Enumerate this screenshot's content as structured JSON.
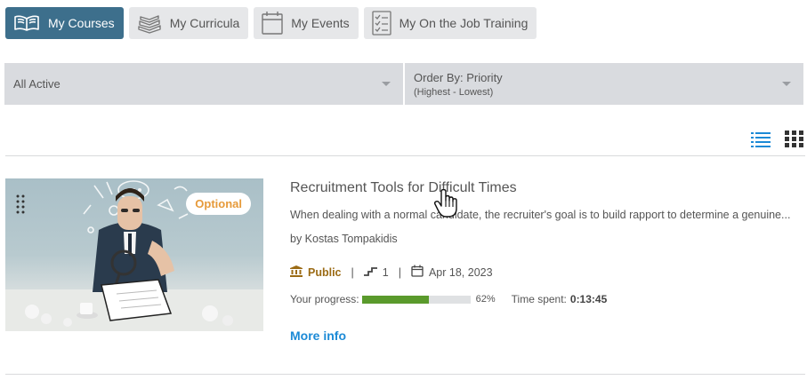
{
  "tabs": [
    {
      "label": "My Courses",
      "icon": "open-book-icon",
      "active": true
    },
    {
      "label": "My Curricula",
      "icon": "books-stack-icon",
      "active": false
    },
    {
      "label": "My Events",
      "icon": "calendar-icon",
      "active": false
    },
    {
      "label": "My On the Job Training",
      "icon": "checklist-icon",
      "active": false
    }
  ],
  "filters": {
    "status": {
      "selected": "All Active"
    },
    "order": {
      "selected": "Order By: Priority",
      "sub": "(Highest - Lowest)"
    }
  },
  "view_toggle": {
    "list_icon": "list-view-icon",
    "grid_icon": "grid-view-icon",
    "active": "list",
    "accent": "#1c8ad6"
  },
  "course": {
    "badge": "Optional",
    "title": "Recruitment Tools for Difficult Times",
    "description": "When dealing with a normal candidate, the recruiter's goal is to build rapport to determine a genuine...",
    "author": "by Kostas Tompakidis",
    "visibility": "Public",
    "sep1": "|",
    "steps": "1",
    "sep2": "|",
    "date": "Apr 18, 2023",
    "progress_label": "Your progress:",
    "progress_percent": 62,
    "progress_text": "62%",
    "time_label": "Time spent:",
    "time_value": "0:13:45",
    "more_info": "More info"
  },
  "colors": {
    "tab_active": "#3d6f8c",
    "progress": "#5a9a2c",
    "link": "#1c8ad6",
    "badge": "#e69a3a",
    "public": "#9b6b15"
  }
}
